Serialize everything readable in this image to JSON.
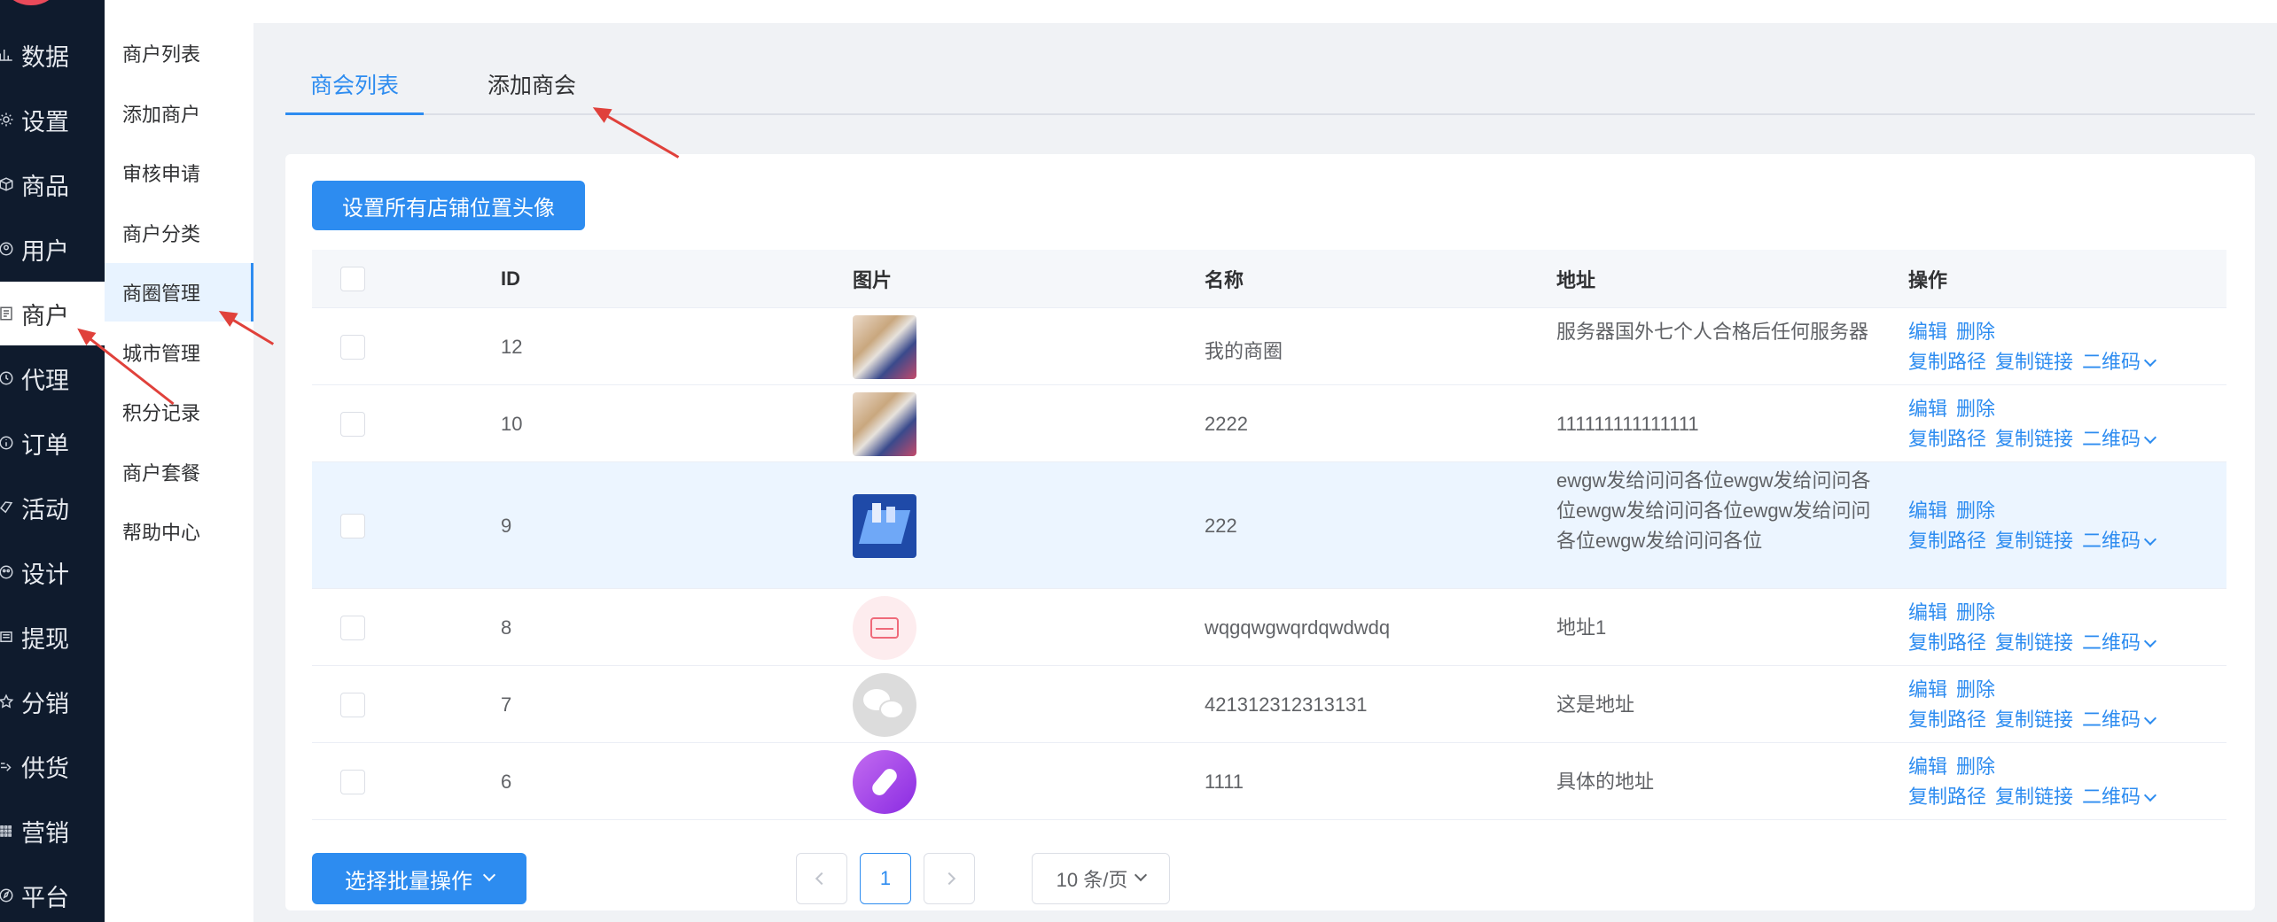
{
  "main_nav": [
    {
      "label": "数据",
      "icon": "bar-chart-icon"
    },
    {
      "label": "设置",
      "icon": "gear-icon"
    },
    {
      "label": "商品",
      "icon": "box-icon"
    },
    {
      "label": "用户",
      "icon": "user-icon"
    },
    {
      "label": "商户",
      "icon": "list-icon",
      "active": true
    },
    {
      "label": "代理",
      "icon": "clock-icon"
    },
    {
      "label": "订单",
      "icon": "info-icon"
    },
    {
      "label": "活动",
      "icon": "tag-icon"
    },
    {
      "label": "设计",
      "icon": "palette-icon"
    },
    {
      "label": "提现",
      "icon": "document-icon"
    },
    {
      "label": "分销",
      "icon": "star-icon"
    },
    {
      "label": "供货",
      "icon": "share-icon"
    },
    {
      "label": "营销",
      "icon": "grid-icon"
    },
    {
      "label": "平台",
      "icon": "compass-icon"
    }
  ],
  "sub_nav": [
    {
      "label": "商户列表"
    },
    {
      "label": "添加商户"
    },
    {
      "label": "审核申请"
    },
    {
      "label": "商户分类"
    },
    {
      "label": "商圈管理",
      "active": true
    },
    {
      "label": "城市管理"
    },
    {
      "label": "积分记录"
    },
    {
      "label": "商户套餐"
    },
    {
      "label": "帮助中心"
    }
  ],
  "tabs": [
    {
      "label": "商会列表",
      "active": true
    },
    {
      "label": "添加商会"
    }
  ],
  "toolbar": {
    "set_avatar_label": "设置所有店铺位置头像"
  },
  "table": {
    "columns": [
      "ID",
      "图片",
      "名称",
      "地址",
      "操作"
    ],
    "rows": [
      {
        "id": "12",
        "image": "product-photo",
        "name": "我的商圈",
        "address": "服务器国外七个人合格后任何服务器"
      },
      {
        "id": "10",
        "image": "product-photo",
        "name": "2222",
        "address": "111111111111111"
      },
      {
        "id": "9",
        "image": "city-illustration",
        "name": "222",
        "address": "ewgw发给问问各位ewgw发给问问各位ewgw发给问问各位ewgw发给问问各位ewgw发给问问各位"
      },
      {
        "id": "8",
        "image": "card-icon",
        "name": "wqgqwgwqrdqwdwdq",
        "address": "地址1"
      },
      {
        "id": "7",
        "image": "wechat-icon",
        "name": "421312312313131",
        "address": "这是地址"
      },
      {
        "id": "6",
        "image": "microphone-icon",
        "name": "1111",
        "address": "具体的地址"
      }
    ],
    "actions": {
      "edit": "编辑",
      "delete": "删除",
      "copy_path": "复制路径",
      "copy_link": "复制链接",
      "qrcode": "二维码"
    }
  },
  "footer": {
    "batch_label": "选择批量操作",
    "current_page": "1",
    "page_size": "10 条/页"
  },
  "colors": {
    "primary": "#2d8cf0",
    "sidebar": "#0f1b2d",
    "annotation_arrow": "#e0413b"
  }
}
